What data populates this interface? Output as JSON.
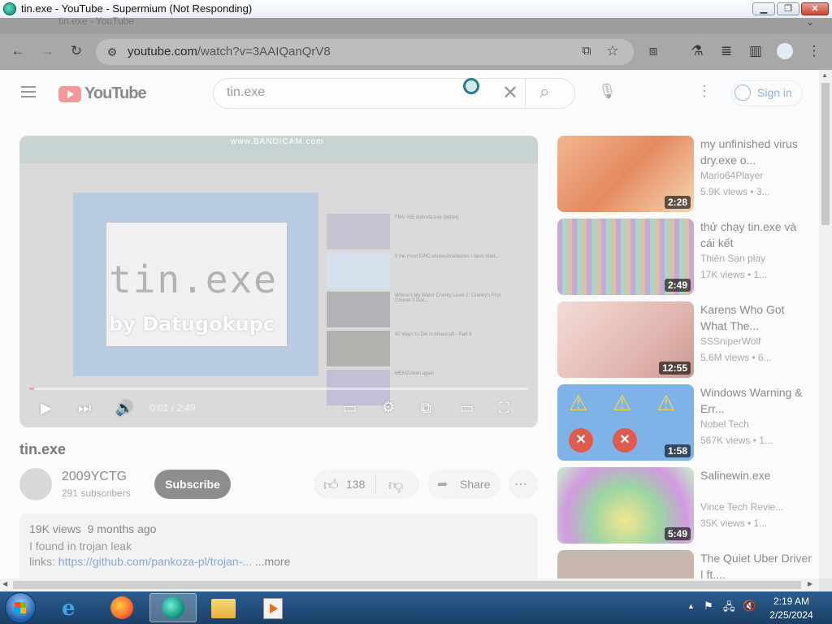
{
  "window": {
    "title": "tin.exe - YouTube - Supermium (Not Responding)"
  },
  "tabs": {
    "active_tab": "tin.exe - YouTube"
  },
  "toolbar": {
    "url_host": "youtube.com",
    "url_rest": "/watch?v=3AAIQanQrV8"
  },
  "header": {
    "logo_text": "YouTube",
    "search_value": "tin.exe",
    "sign_in": "Sign in"
  },
  "player": {
    "watermark": "www.BANDICAM.com",
    "overlay_title": "tin.exe",
    "overlay_credit": "by Datugokupc",
    "time": "0:01 / 2:49",
    "progress": 0.006
  },
  "video": {
    "title": "tin.exe",
    "channel": "2009YCTG",
    "subscribers": "291 subscribers",
    "subscribe": "Subscribe",
    "likes": "138",
    "share": "Share",
    "views": "19K views",
    "age": "9 months ago",
    "description_line": "I found in trojan leak",
    "links_label": "links: ",
    "link": "https://github.com/pankoza-pl/trojan-...",
    "more": "...more"
  },
  "recommendations": [
    {
      "title": "my unfinished virus dry.exe o...",
      "channel": "Mario64Player",
      "meta": "5.9K views • 3...",
      "duration": "2:28",
      "color": "#e3a07e"
    },
    {
      "title": "thử chạy tin.exe và cái kết",
      "channel": "Thiên Sạn play",
      "meta": "17K views • 1...",
      "duration": "2:49",
      "color": "#b9a7c4"
    },
    {
      "title": "Karens Who Got What The...",
      "channel": "SSSniperWolf",
      "meta": "5.6M views • 6...",
      "duration": "12:55",
      "color": "#e6c5c0"
    },
    {
      "title": "Windows Warning & Err...",
      "channel": "Nobel Tech",
      "meta": "567K views • 1...",
      "duration": "1:58",
      "color": "#7fb3e8"
    },
    {
      "title": "Salinewin.exe",
      "channel": "Vince Tech Revie...",
      "meta": "35K views • 1...",
      "duration": "5:49",
      "color": "#a9d3a0"
    },
    {
      "title": "The Quiet Uber Driver | ft....",
      "channel": "",
      "meta": "",
      "duration": "",
      "color": "#c8b7ad"
    }
  ],
  "inner_list": [
    {
      "text": "FMV #35 dobrota.exe (better)"
    },
    {
      "text": "5 the most EPIC viruses/malwares I have tried..."
    },
    {
      "text": "Where's My Water Cranky Level 1: Cranky's First Course 3 Duc..."
    },
    {
      "text": "50 Ways to Die in Minecraft - Part 9"
    },
    {
      "text": "MEMZclean again"
    }
  ],
  "taskbar": {
    "time": "2:19 AM",
    "date": "2/25/2024"
  }
}
